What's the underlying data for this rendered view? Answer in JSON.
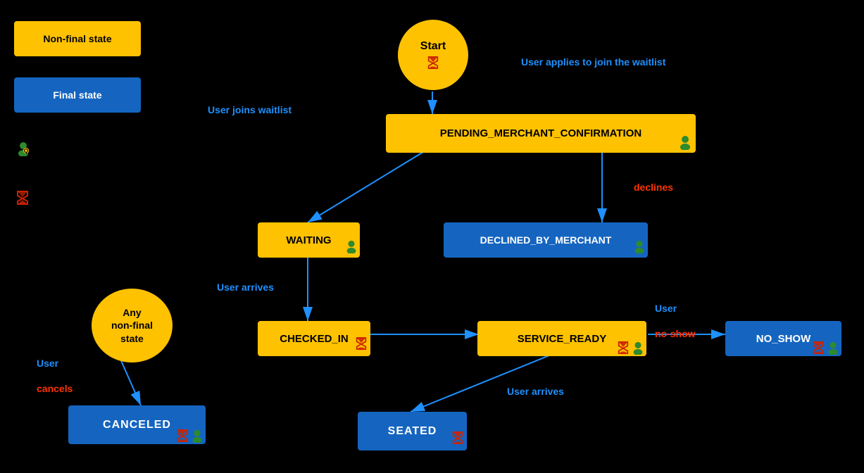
{
  "legend": {
    "non_final_label": "Non-final state",
    "final_label": "Final state",
    "non_final_color": "#FFC200",
    "final_color": "#1565C0"
  },
  "states": {
    "start": "Start",
    "any_non_final": "Any\nnon-final\nstate",
    "pending": "PENDING_MERCHANT_CONFIRMATION",
    "waiting": "WAITING",
    "declined": "DECLINED_BY_MERCHANT",
    "checked_in": "CHECKED_IN",
    "service_ready": "SERVICE_READY",
    "no_show": "NO_SHOW",
    "canceled": "CANCELED",
    "seated": "SEATED"
  },
  "transitions": {
    "user_applies": "User applies to join the waitlist",
    "user_joins": "User joins waitlist",
    "declines": "declines",
    "user_arrives_1": "User arrives",
    "user_cancels_label": "User",
    "user_cancels": "cancels",
    "user_noshow_label": "User\nno-show",
    "user_arrives_2": "User arrives"
  }
}
